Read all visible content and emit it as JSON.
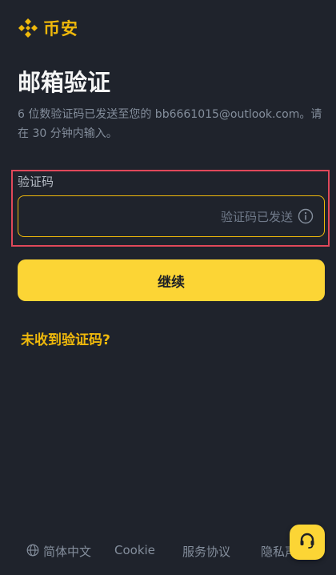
{
  "brand": {
    "name": "币安",
    "accent_color": "#f0b90b"
  },
  "page": {
    "title": "邮箱验证",
    "description": "6 位数验证码已发送至您的 bb6661015@outlook.com。请在 30 分钟内输入。"
  },
  "code_field": {
    "label": "验证码",
    "value": "",
    "status_text": "验证码已发送",
    "info_icon": "info-circle-icon"
  },
  "actions": {
    "continue_label": "继续",
    "resend_label": "未收到验证码?"
  },
  "footer": {
    "language_label": "简体中文",
    "cookie_label": "Cookie",
    "terms_label": "服务协议",
    "privacy_label": "隐私声"
  },
  "support": {
    "icon": "headset-icon",
    "button_color": "#fcd535"
  }
}
